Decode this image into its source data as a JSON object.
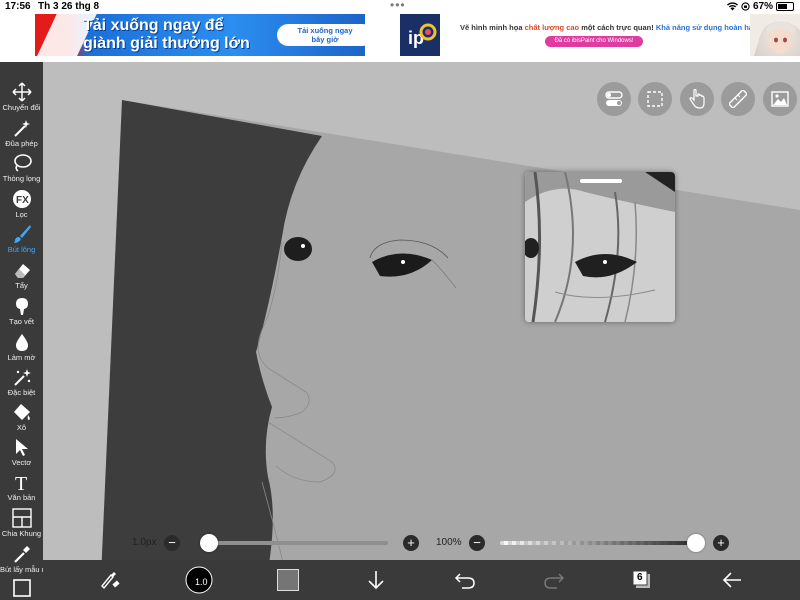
{
  "status": {
    "time": "17:56",
    "date": "Th 3 26 thg 8",
    "battery": "67%",
    "battery_level": 0.67
  },
  "ads": {
    "left_headline_line1": "Tải xuống ngay để",
    "left_headline_line2": "giành giải thưởng lớn",
    "left_cta_line1": "Tải xuống ngay",
    "left_cta_line2": "bây giờ",
    "right_text_part1": "Vẽ hình minh họa",
    "right_text_part2": "chất lượng cao",
    "right_text_part3": "một cách trực quan!",
    "right_text_part4": "Khả năng sử dụng hoàn hảo!",
    "right_button": "Đã có ibisPaint cho Windows!"
  },
  "toolbar": {
    "items": [
      {
        "label": "Chuyển đổi",
        "icon": "move-icon"
      },
      {
        "label": "Đũa phép",
        "icon": "magic-wand-icon"
      },
      {
        "label": "Thòng lọng",
        "icon": "lasso-icon"
      },
      {
        "label": "Lọc",
        "icon": "fx-icon"
      },
      {
        "label": "Bút lông",
        "icon": "brush-icon",
        "active": true
      },
      {
        "label": "Tẩy",
        "icon": "eraser-icon"
      },
      {
        "label": "Tạo vết",
        "icon": "smudge-icon"
      },
      {
        "label": "Làm mờ",
        "icon": "blur-icon"
      },
      {
        "label": "Đặc biệt",
        "icon": "special-icon"
      },
      {
        "label": "Xô",
        "icon": "bucket-icon"
      },
      {
        "label": "Vectơ",
        "icon": "vector-icon"
      },
      {
        "label": "Văn bản",
        "icon": "text-icon"
      },
      {
        "label": "Chia Khung",
        "icon": "frame-divider-icon"
      },
      {
        "label": "Bút lấy mẫu màu",
        "icon": "eyedropper-icon"
      }
    ],
    "active_color": "#3fa7ff"
  },
  "sliders": {
    "size_label": "1.0px",
    "size_value": 0.05,
    "opacity_label": "100%",
    "opacity_value": 1.0,
    "minus": "−",
    "plus": "+"
  },
  "bottombar": {
    "brush_size": "1.0",
    "layer_count": "6"
  }
}
